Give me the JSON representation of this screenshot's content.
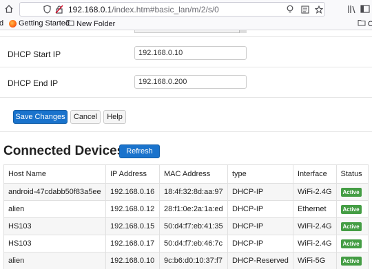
{
  "browser": {
    "url_host": "192.168.0.1",
    "url_path": "/index.htm#basic_lan/m/2/s/0",
    "bookmarks": [
      {
        "label": "d"
      },
      {
        "label": "Getting Started"
      },
      {
        "label": "New Folder"
      },
      {
        "label": "O"
      }
    ]
  },
  "form": {
    "dhcp_start_label": "DHCP Start IP",
    "dhcp_start_value": "192.168.0.10",
    "dhcp_end_label": "DHCP End IP",
    "dhcp_end_value": "192.168.0.200"
  },
  "actions": {
    "save_label": "Save Changes",
    "cancel_label": "Cancel",
    "help_label": "Help"
  },
  "devices": {
    "title": "Connected Devices",
    "refresh_label": "Refresh",
    "columns": [
      "Host Name",
      "IP Address",
      "MAC Address",
      "type",
      "Interface",
      "Status"
    ],
    "rows": [
      {
        "host": "android-47cdabb50f83a5ee",
        "ip": "192.168.0.16",
        "mac": "18:4f:32:8d:aa:97",
        "type": "DHCP-IP",
        "iface": "WiFi-2.4G",
        "status": "Active"
      },
      {
        "host": "alien",
        "ip": "192.168.0.12",
        "mac": "28:f1:0e:2a:1a:ed",
        "type": "DHCP-IP",
        "iface": "Ethernet",
        "status": "Active"
      },
      {
        "host": "HS103",
        "ip": "192.168.0.15",
        "mac": "50:d4:f7:eb:41:35",
        "type": "DHCP-IP",
        "iface": "WiFi-2.4G",
        "status": "Active"
      },
      {
        "host": "HS103",
        "ip": "192.168.0.17",
        "mac": "50:d4:f7:eb:46:7c",
        "type": "DHCP-IP",
        "iface": "WiFi-2.4G",
        "status": "Active"
      },
      {
        "host": "alien",
        "ip": "192.168.0.10",
        "mac": "9c:b6:d0:10:37:f7",
        "type": "DHCP-Reserved",
        "iface": "WiFi-5G",
        "status": "Active"
      }
    ]
  },
  "colors": {
    "primary": "#1a73cc",
    "active_badge": "#449d44"
  }
}
